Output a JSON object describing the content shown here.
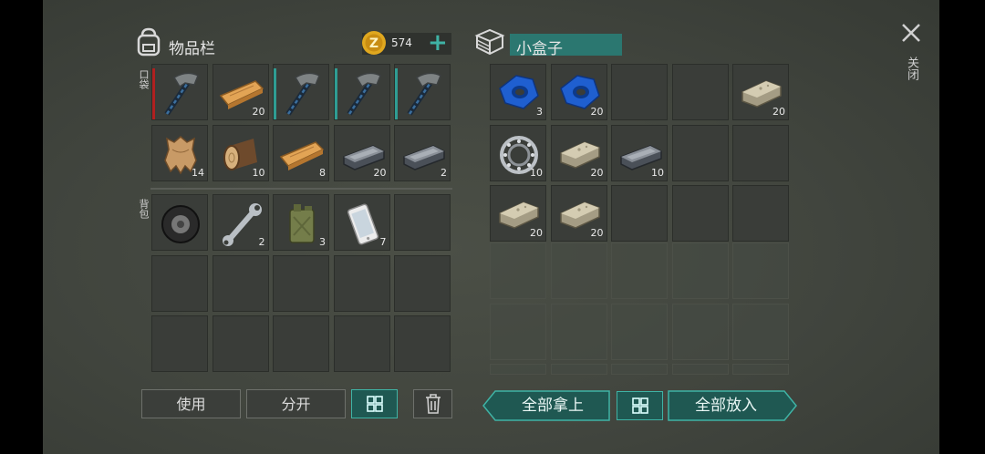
{
  "inventory": {
    "title": "物品栏",
    "coins": "574",
    "pocket_label": "口袋",
    "backpack_label": "背包",
    "pocket": [
      {
        "icon": "pickaxe-icon",
        "qty": "",
        "dur": "#b02020"
      },
      {
        "icon": "plank-icon",
        "qty": "20"
      },
      {
        "icon": "pickaxe-icon",
        "qty": "",
        "dur": "#2f9d93"
      },
      {
        "icon": "pickaxe-icon",
        "qty": "",
        "dur": "#2f9d93"
      },
      {
        "icon": "pickaxe-icon",
        "qty": "",
        "dur": "#2f9d93"
      },
      {
        "icon": "hide-icon",
        "qty": "14"
      },
      {
        "icon": "log-icon",
        "qty": "10"
      },
      {
        "icon": "plank-icon",
        "qty": "8"
      },
      {
        "icon": "iron-ingot-icon",
        "qty": "20"
      },
      {
        "icon": "iron-ingot-icon",
        "qty": "2"
      }
    ],
    "backpack": [
      {
        "icon": "wheel-icon",
        "qty": ""
      },
      {
        "icon": "wrench-icon",
        "qty": "2"
      },
      {
        "icon": "jerrycan-icon",
        "qty": "3"
      },
      {
        "icon": "phone-icon",
        "qty": "7"
      },
      {},
      {},
      {},
      {},
      {},
      {},
      {},
      {},
      {},
      {},
      {}
    ]
  },
  "box": {
    "title": "小盒子",
    "items": [
      {
        "icon": "tape-icon",
        "qty": "3"
      },
      {
        "icon": "tape-icon",
        "qty": "20"
      },
      {},
      {},
      {
        "icon": "stone-icon",
        "qty": "20"
      },
      {
        "icon": "bearing-icon",
        "qty": "10"
      },
      {
        "icon": "stone-icon",
        "qty": "20"
      },
      {
        "icon": "iron-ingot-icon",
        "qty": "10"
      },
      {},
      {},
      {
        "icon": "stone-icon",
        "qty": "20"
      },
      {
        "icon": "stone-icon",
        "qty": "20"
      },
      {},
      {},
      {}
    ]
  },
  "buttons": {
    "use": "使用",
    "split": "分开",
    "take_all": "全部拿上",
    "put_all": "全部放入"
  },
  "close_label": "关闭"
}
